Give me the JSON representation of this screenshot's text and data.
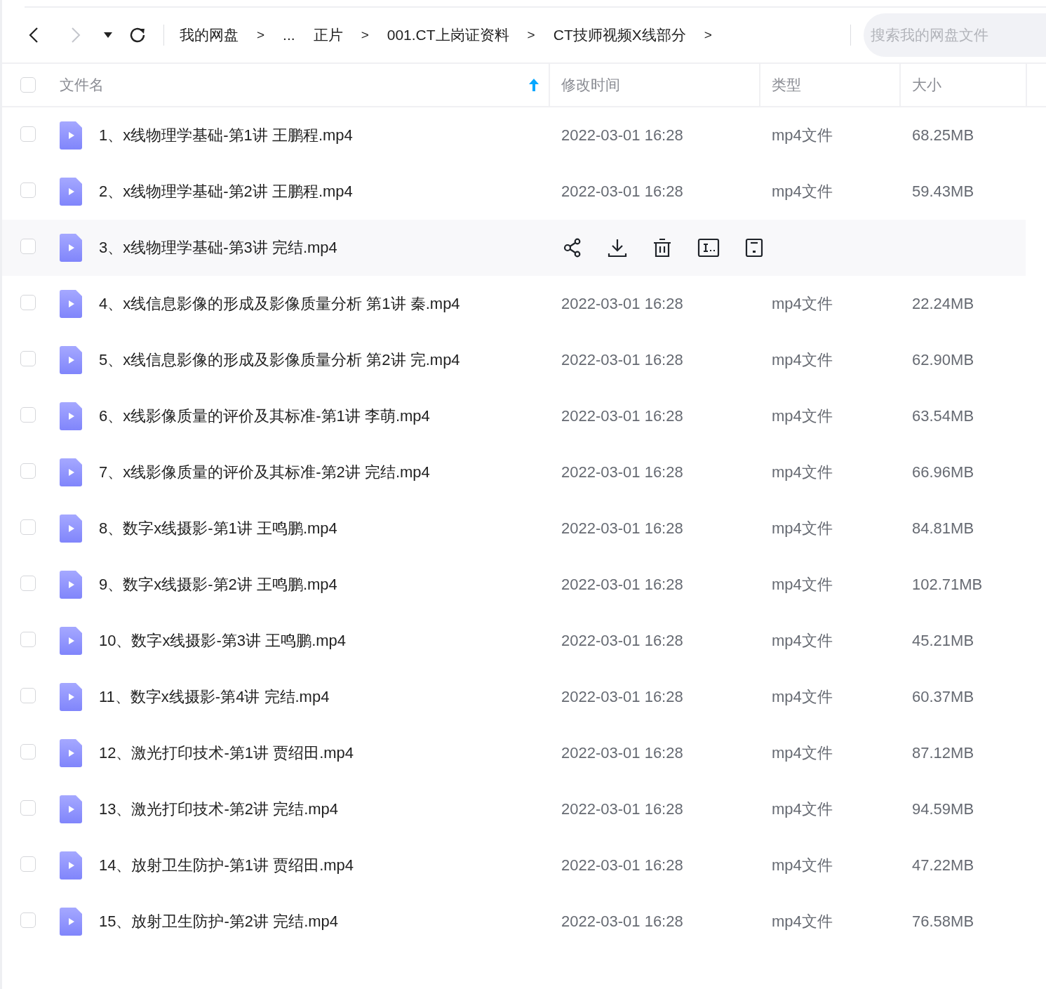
{
  "toolbar": {
    "back": {
      "disabled": false
    },
    "forward": {
      "disabled": true
    },
    "breadcrumbs": [
      {
        "kind": "crumb",
        "text": "我的网盘"
      },
      {
        "kind": "separator",
        "text": ">"
      },
      {
        "kind": "crumb",
        "text": "..."
      },
      {
        "kind": "crumb",
        "text": "正片"
      },
      {
        "kind": "separator",
        "text": ">"
      },
      {
        "kind": "crumb",
        "text": "001.CT上岗证资料"
      },
      {
        "kind": "separator",
        "text": ">"
      },
      {
        "kind": "crumb",
        "text": "CT技师视频X线部分"
      },
      {
        "kind": "separator",
        "text": ">"
      }
    ],
    "search": {
      "placeholder": "搜索我的网盘文件"
    }
  },
  "table": {
    "select_all": {
      "checked": false
    },
    "columns": [
      {
        "label": "文件名",
        "sorted": true
      },
      {
        "label": "修改时间",
        "sorted": false
      },
      {
        "label": "类型",
        "sorted": false
      },
      {
        "label": "大小",
        "sorted": false
      }
    ],
    "rows": [
      {
        "name": "1、x线物理学基础-第1讲 王鹏程.mp4",
        "date": "2022-03-01 16:28",
        "type": "mp4文件",
        "size": "68.25MB",
        "hovered": false,
        "checked": false
      },
      {
        "name": "2、x线物理学基础-第2讲 王鹏程.mp4",
        "date": "2022-03-01 16:28",
        "type": "mp4文件",
        "size": "59.43MB",
        "hovered": false,
        "checked": false
      },
      {
        "name": "3、x线物理学基础-第3讲 完结.mp4",
        "hovered": true,
        "checked": false
      },
      {
        "name": "4、x线信息影像的形成及影像质量分析 第1讲 秦.mp4",
        "date": "2022-03-01 16:28",
        "type": "mp4文件",
        "size": "22.24MB",
        "hovered": false,
        "checked": false
      },
      {
        "name": "5、x线信息影像的形成及影像质量分析 第2讲 完.mp4",
        "date": "2022-03-01 16:28",
        "type": "mp4文件",
        "size": "62.90MB",
        "hovered": false,
        "checked": false
      },
      {
        "name": "6、x线影像质量的评价及其标准-第1讲 李萌.mp4",
        "date": "2022-03-01 16:28",
        "type": "mp4文件",
        "size": "63.54MB",
        "hovered": false,
        "checked": false
      },
      {
        "name": "7、x线影像质量的评价及其标准-第2讲 完结.mp4",
        "date": "2022-03-01 16:28",
        "type": "mp4文件",
        "size": "66.96MB",
        "hovered": false,
        "checked": false
      },
      {
        "name": "8、数字x线摄影-第1讲 王鸣鹏.mp4",
        "date": "2022-03-01 16:28",
        "type": "mp4文件",
        "size": "84.81MB",
        "hovered": false,
        "checked": false
      },
      {
        "name": "9、数字x线摄影-第2讲 王鸣鹏.mp4",
        "date": "2022-03-01 16:28",
        "type": "mp4文件",
        "size": "102.71MB",
        "hovered": false,
        "checked": false
      },
      {
        "name": "10、数字x线摄影-第3讲 王鸣鹏.mp4",
        "date": "2022-03-01 16:28",
        "type": "mp4文件",
        "size": "45.21MB",
        "hovered": false,
        "checked": false
      },
      {
        "name": "11、数字x线摄影-第4讲 完结.mp4",
        "date": "2022-03-01 16:28",
        "type": "mp4文件",
        "size": "60.37MB",
        "hovered": false,
        "checked": false
      },
      {
        "name": "12、激光打印技术-第1讲 贾绍田.mp4",
        "date": "2022-03-01 16:28",
        "type": "mp4文件",
        "size": "87.12MB",
        "hovered": false,
        "checked": false
      },
      {
        "name": "13、激光打印技术-第2讲 完结.mp4",
        "date": "2022-03-01 16:28",
        "type": "mp4文件",
        "size": "94.59MB",
        "hovered": false,
        "checked": false
      },
      {
        "name": "14、放射卫生防护-第1讲 贾绍田.mp4",
        "date": "2022-03-01 16:28",
        "type": "mp4文件",
        "size": "47.22MB",
        "hovered": false,
        "checked": false
      },
      {
        "name": "15、放射卫生防护-第2讲 完结.mp4",
        "date": "2022-03-01 16:28",
        "type": "mp4文件",
        "size": "76.58MB",
        "hovered": false,
        "checked": false
      }
    ]
  }
}
